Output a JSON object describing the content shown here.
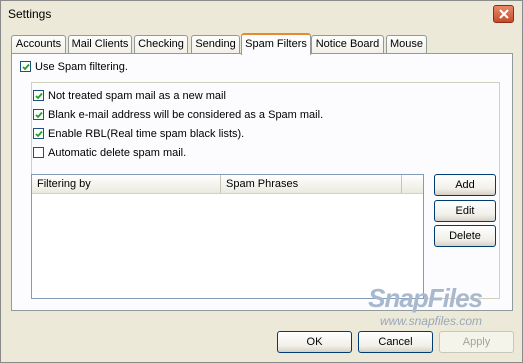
{
  "window": {
    "title": "Settings"
  },
  "tabs": [
    {
      "label": "Accounts"
    },
    {
      "label": "Mail Clients"
    },
    {
      "label": "Checking"
    },
    {
      "label": "Sending"
    },
    {
      "label": "Spam Filters"
    },
    {
      "label": "Notice Board"
    },
    {
      "label": "Mouse"
    }
  ],
  "active_tab": "Spam Filters",
  "spam": {
    "use_filtering": {
      "label": "Use Spam filtering.",
      "checked": true
    },
    "options": [
      {
        "label": "Not treated spam mail as a new mail",
        "checked": true
      },
      {
        "label": "Blank e-mail address will be considered as a Spam mail.",
        "checked": true
      },
      {
        "label": "Enable RBL(Real time spam black lists).",
        "checked": true
      },
      {
        "label": "Automatic delete spam mail.",
        "checked": false
      }
    ],
    "table": {
      "columns": [
        "Filtering by",
        "Spam Phrases"
      ],
      "rows": []
    },
    "buttons": {
      "add": "Add",
      "edit": "Edit",
      "delete": "Delete"
    }
  },
  "footer": {
    "ok": "OK",
    "cancel": "Cancel",
    "apply": "Apply",
    "apply_enabled": false
  },
  "watermark": {
    "logo": "SnapFiles",
    "url": "www.snapfiles.com"
  }
}
